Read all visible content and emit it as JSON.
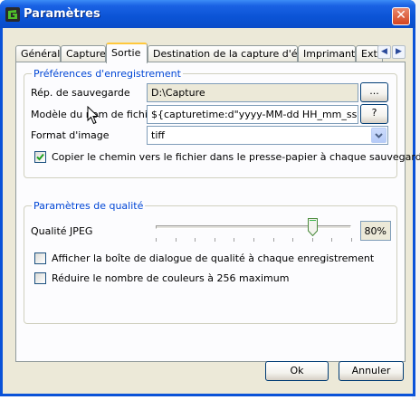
{
  "window": {
    "title": "Paramètres",
    "close_glyph": "✕"
  },
  "tabs": [
    "Général",
    "Capture",
    "Sortie",
    "Destination de la capture d'écran",
    "Imprimante",
    "Exte"
  ],
  "active_tab": "Sortie",
  "tab_scroll": {
    "left_glyph": "◀",
    "right_glyph": "▶"
  },
  "save_prefs": {
    "legend": "Préférences d'enregistrement",
    "dir_label": "Rép. de sauvegarde",
    "dir_value": "D:\\Capture",
    "browse_label": "...",
    "pattern_label": "Modèle du nom de fichier",
    "pattern_value": "${capturetime:d\"yyyy-MM-dd HH_mm_ss\"}-${titl",
    "help_label": "?",
    "format_label": "Format d'image",
    "format_value": "tiff",
    "copy_path_label": "Copier le chemin vers le fichier dans le presse-papier à chaque sauvegarde",
    "copy_path_checked": true
  },
  "quality": {
    "legend": "Paramètres de qualité",
    "jpeg_label": "Qualité JPEG",
    "jpeg_value": "80%",
    "jpeg_fraction": 0.8,
    "show_dialog_label": "Afficher la boîte de dialogue de qualité à chaque enregistrement",
    "show_dialog_checked": false,
    "reduce_colors_label": "Réduire le nombre de couleurs à 256 maximum",
    "reduce_colors_checked": false
  },
  "footer": {
    "ok_label": "Ok",
    "cancel_label": "Annuler"
  },
  "colors": {
    "legend": "#0046d5",
    "titlebar": "#0a52d8",
    "face": "#ece9d8"
  },
  "icons": [
    "greenshot-app-icon",
    "close-icon",
    "chevron-down-icon",
    "check-icon",
    "mouse-cursor-icon"
  ]
}
